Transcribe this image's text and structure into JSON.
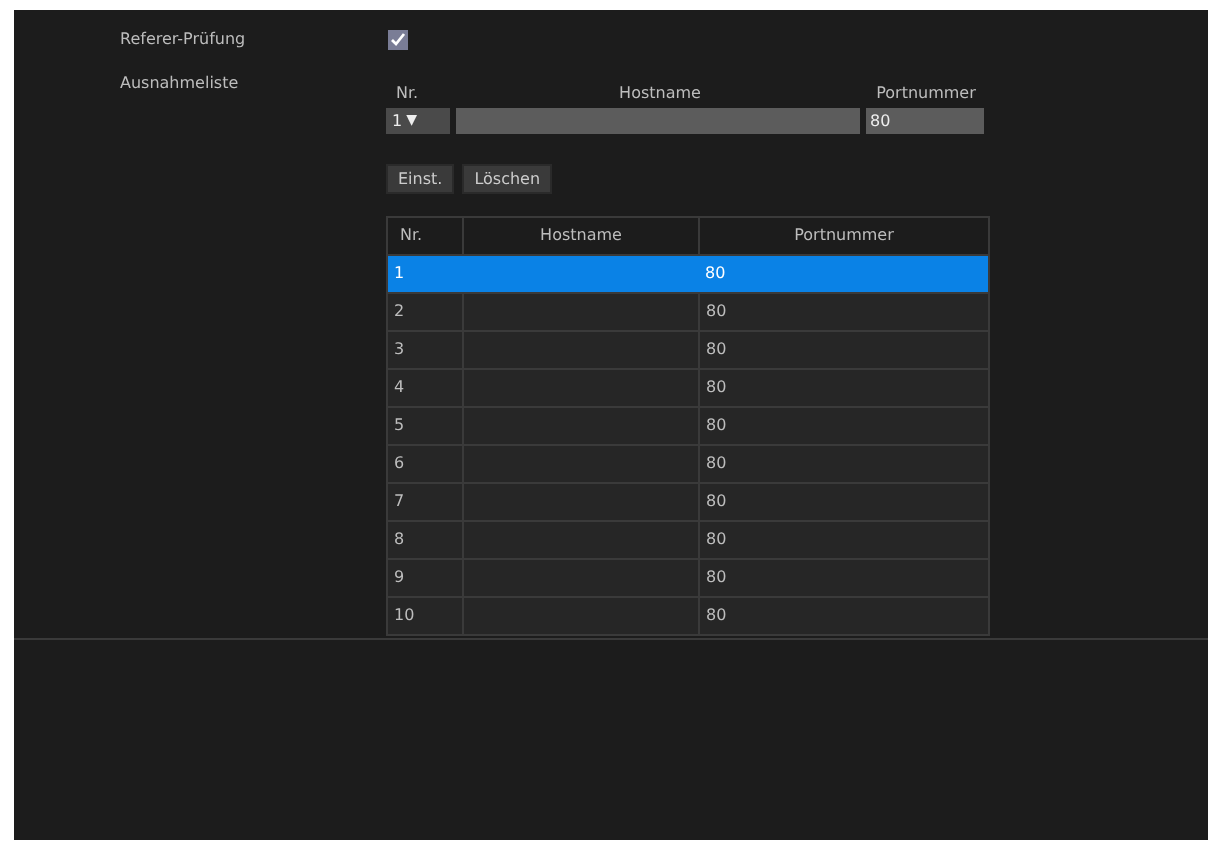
{
  "settings": [
    {
      "label": "Referer-Prüfung",
      "kind": "checkbox",
      "checked": true
    },
    {
      "label": "Ausnahmeliste",
      "kind": "list"
    }
  ],
  "entry_form": {
    "labels": [
      "Nr.",
      "Hostname",
      "Portnummer"
    ],
    "number": "1",
    "arrow": "▼",
    "port": "80"
  },
  "buttons": [
    "Einst.",
    "Löschen"
  ],
  "table": {
    "columns": [
      "Nr.",
      "Hostname",
      "Portnummer"
    ],
    "rows": [
      {
        "nr": "1",
        "port": "80",
        "selected": true
      },
      {
        "nr": "2",
        "port": "80",
        "selected": false
      },
      {
        "nr": "3",
        "port": "80",
        "selected": false
      },
      {
        "nr": "4",
        "port": "80",
        "selected": false
      },
      {
        "nr": "5",
        "port": "80",
        "selected": false
      },
      {
        "nr": "6",
        "port": "80",
        "selected": false
      },
      {
        "nr": "7",
        "port": "80",
        "selected": false
      },
      {
        "nr": "8",
        "port": "80",
        "selected": false
      },
      {
        "nr": "9",
        "port": "80",
        "selected": false
      },
      {
        "nr": "10",
        "port": "80",
        "selected": false
      }
    ]
  }
}
